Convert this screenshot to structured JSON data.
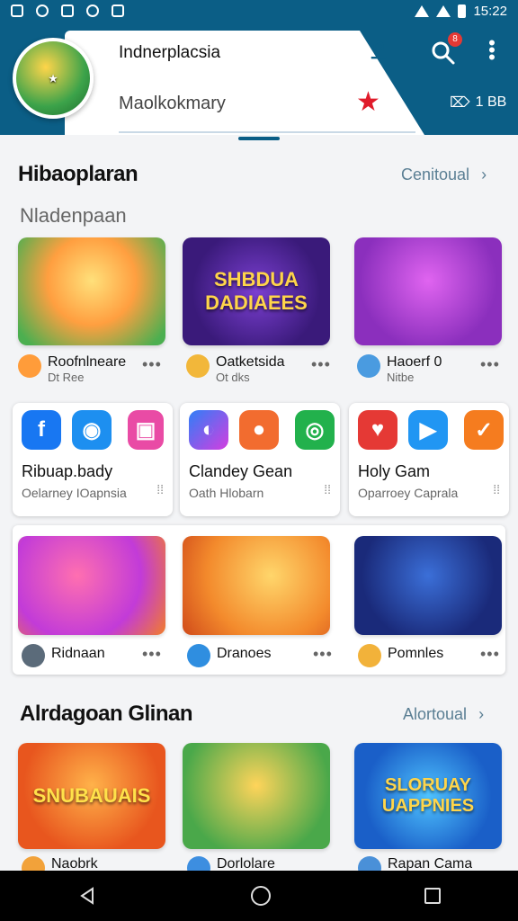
{
  "status": {
    "time": "15:22"
  },
  "header": {
    "title": "Indnerplacsia",
    "subtitle": "Maolkokmary",
    "badge_count": "8",
    "tag_text": "1 BB"
  },
  "section1": {
    "title": "Hibaoplaran",
    "link": "Cenitoual",
    "subtitle": "Nladenpaan",
    "games": [
      {
        "name": "Roofnlneare",
        "sub": "Dt Ree",
        "banner": ""
      },
      {
        "name": "Oatketsida",
        "sub": "Ot dks",
        "banner": "SHBDUA DADIAEES"
      },
      {
        "name": "Haoerf 0",
        "sub": "Nitbe",
        "banner": ""
      }
    ],
    "cards": [
      {
        "title": "Ribuap.bady",
        "sub": "Oelarney IOapnsia"
      },
      {
        "title": "Clandey Gean",
        "sub": "Oath Hlobarn"
      },
      {
        "title": "Holy Gam",
        "sub": "Oparroey Caprala"
      }
    ],
    "games2": [
      {
        "name": "Ridnaan"
      },
      {
        "name": "Dranoes"
      },
      {
        "name": "Pomnles"
      }
    ]
  },
  "section2": {
    "title": "Alrdagoan Glinan",
    "link": "Alortoual",
    "games": [
      {
        "name": "Naobrk",
        "banner": "SNUBAUAIS"
      },
      {
        "name": "Dorlolare",
        "banner": ""
      },
      {
        "name": "Rapan Cama",
        "banner": "SLORUAY UAPPNIES"
      }
    ]
  },
  "colors": {
    "brand": "#0b5e86",
    "accent": "#e01b2a"
  }
}
